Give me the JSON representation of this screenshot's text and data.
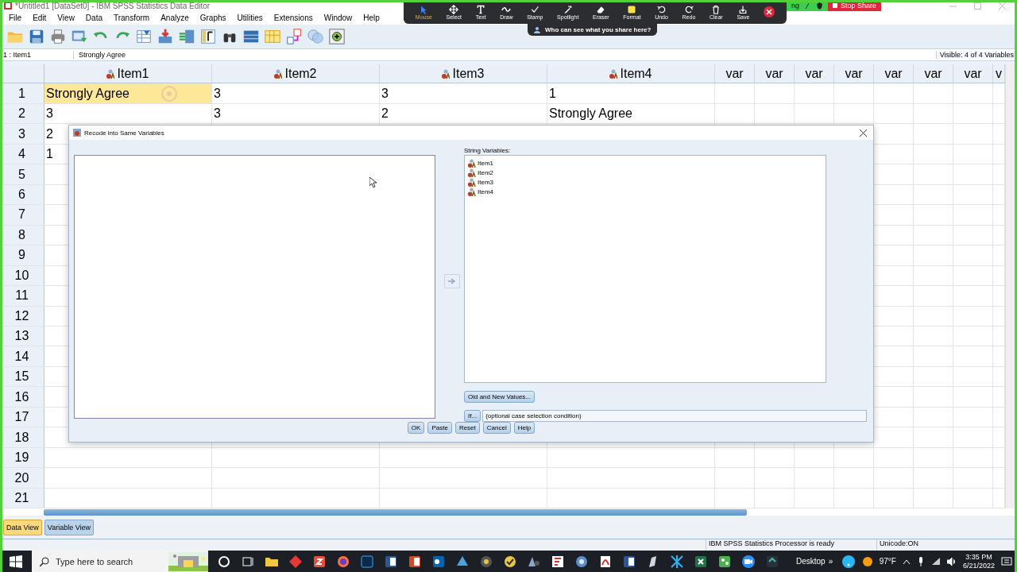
{
  "window": {
    "title": "*Untitled1 [DataSet0] - IBM SPSS Statistics Data Editor"
  },
  "menu": [
    "File",
    "Edit",
    "View",
    "Data",
    "Transform",
    "Analyze",
    "Graphs",
    "Utilities",
    "Extensions",
    "Window",
    "Help"
  ],
  "annotation_toolbar": {
    "tools": [
      {
        "label": "Mouse",
        "selected": true
      },
      {
        "label": "Select",
        "selected": false
      },
      {
        "label": "Text",
        "selected": false
      },
      {
        "label": "Draw",
        "selected": false
      },
      {
        "label": "Stamp",
        "selected": false
      },
      {
        "label": "Spotlight",
        "selected": false
      },
      {
        "label": "Eraser",
        "selected": false
      },
      {
        "label": "Format",
        "selected": false
      },
      {
        "label": "Undo",
        "selected": false
      },
      {
        "label": "Redo",
        "selected": false
      },
      {
        "label": "Clear",
        "selected": false
      },
      {
        "label": "Save",
        "selected": false
      }
    ],
    "hint": "Who can see what you share here?"
  },
  "share_bar": {
    "text": "ng",
    "stop_button": "Stop Share"
  },
  "cell_bar": {
    "reference": "1 : Item1",
    "value": "Strongly Agree",
    "visible": "Visible: 4 of 4 Variables"
  },
  "grid": {
    "columns": [
      {
        "label": "Item1",
        "kind": "variable"
      },
      {
        "label": "Item2",
        "kind": "variable"
      },
      {
        "label": "Item3",
        "kind": "variable"
      },
      {
        "label": "Item4",
        "kind": "variable"
      },
      {
        "label": "var",
        "kind": "empty"
      },
      {
        "label": "var",
        "kind": "empty"
      },
      {
        "label": "var",
        "kind": "empty"
      },
      {
        "label": "var",
        "kind": "empty"
      },
      {
        "label": "var",
        "kind": "empty"
      },
      {
        "label": "var",
        "kind": "empty"
      },
      {
        "label": "var",
        "kind": "empty"
      },
      {
        "label": "v",
        "kind": "empty"
      }
    ],
    "rows": [
      {
        "number": "1",
        "cells": [
          {
            "text": "Strongly Agree",
            "selected": true
          },
          {
            "text": "3",
            "selected": false
          },
          {
            "text": "3",
            "selected": false
          },
          {
            "text": "1",
            "selected": false
          }
        ]
      },
      {
        "number": "2",
        "cells": [
          {
            "text": "3",
            "selected": false
          },
          {
            "text": "3",
            "selected": false
          },
          {
            "text": "2",
            "selected": false
          },
          {
            "text": "Strongly Agree",
            "selected": false
          }
        ]
      },
      {
        "number": "3",
        "cells": [
          {
            "text": "2",
            "selected": false
          }
        ]
      },
      {
        "number": "4",
        "cells": [
          {
            "text": "1",
            "selected": false
          }
        ]
      },
      {
        "number": "5"
      },
      {
        "number": "6"
      },
      {
        "number": "7"
      },
      {
        "number": "8"
      },
      {
        "number": "9"
      },
      {
        "number": "10"
      },
      {
        "number": "11"
      },
      {
        "number": "12"
      },
      {
        "number": "13"
      },
      {
        "number": "14"
      },
      {
        "number": "15"
      },
      {
        "number": "16"
      },
      {
        "number": "17"
      },
      {
        "number": "18"
      },
      {
        "number": "19"
      },
      {
        "number": "20"
      },
      {
        "number": "21"
      }
    ]
  },
  "dialog": {
    "title": "Recode into Same Variables",
    "source_label": "String Variables:",
    "source_items": [
      "Item1",
      "Item2",
      "Item3",
      "Item4"
    ],
    "old_new_button": "Old and New Values...",
    "if_button": "If...",
    "condition_field": {
      "value": "(optional case selection condition)"
    },
    "footer_buttons": [
      "OK",
      "Paste",
      "Reset",
      "Cancel",
      "Help"
    ]
  },
  "tabs": [
    {
      "label": "Data View",
      "selected": true
    },
    {
      "label": "Variable View",
      "selected": false
    }
  ],
  "status_bar": {
    "processor": "IBM SPSS Statistics Processor is ready",
    "encoding": "Unicode:ON"
  },
  "taskbar": {
    "search": {
      "placeholder": "Type here to search"
    },
    "desktop": "Desktop",
    "overflow": "»",
    "temperature": "97°F",
    "time": "3:35 PM",
    "date": "6/21/2022"
  }
}
